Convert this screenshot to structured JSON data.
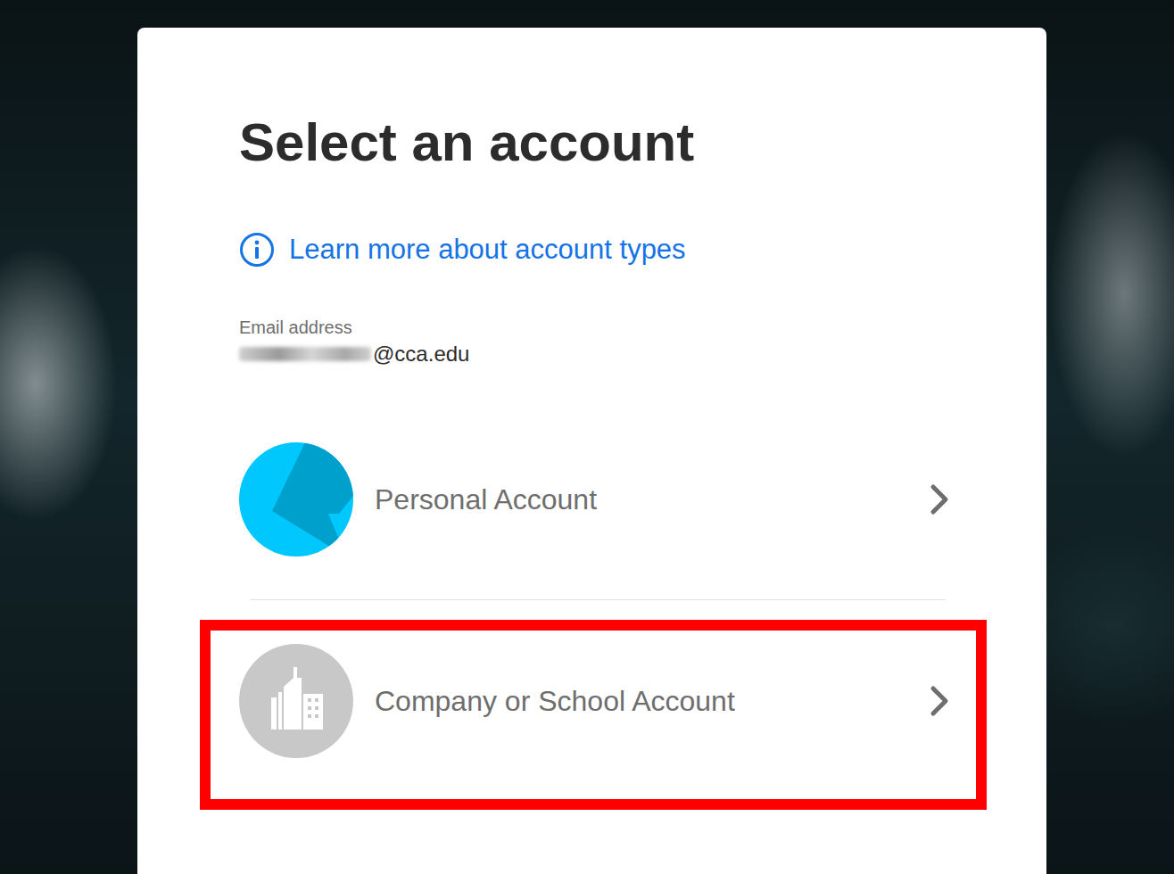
{
  "title": "Select an account",
  "help_link": "Learn more about account types",
  "email": {
    "label": "Email address",
    "value": "@cca.edu"
  },
  "accounts": [
    {
      "label": "Personal Account",
      "kind": "personal",
      "highlighted": false
    },
    {
      "label": "Company or School Account",
      "kind": "company",
      "highlighted": true
    }
  ]
}
